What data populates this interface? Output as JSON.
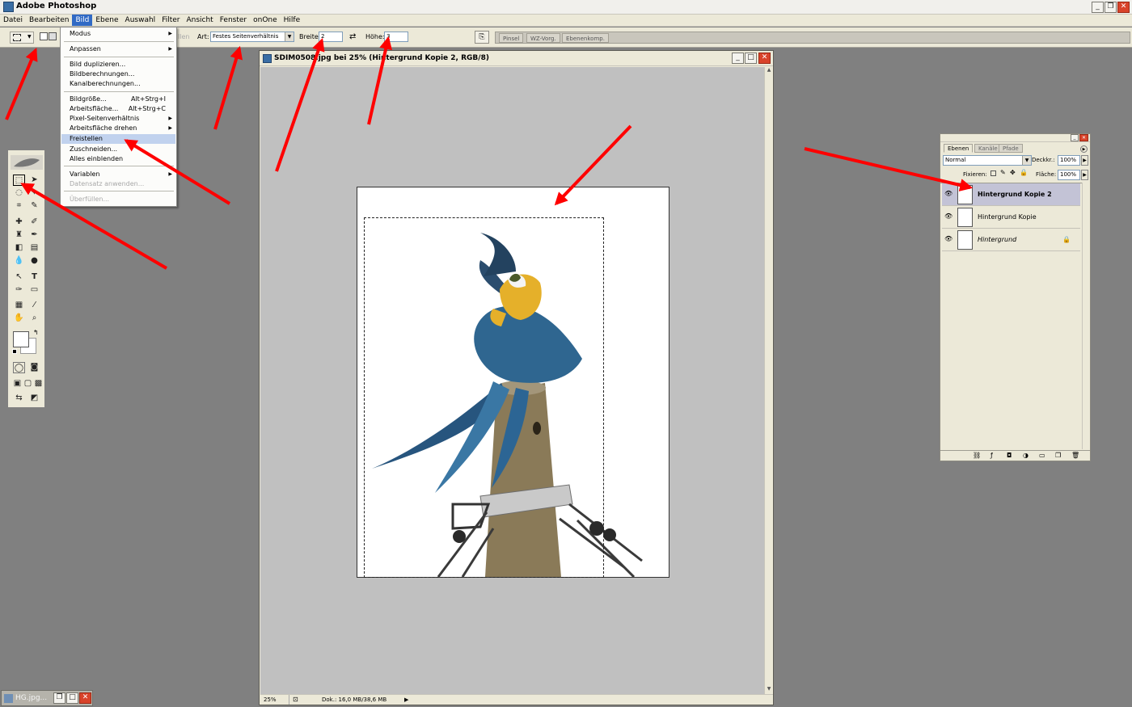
{
  "app": {
    "title": "Adobe Photoshop"
  },
  "menubar": [
    "Datei",
    "Bearbeiten",
    "Bild",
    "Ebene",
    "Auswahl",
    "Filter",
    "Ansicht",
    "Fenster",
    "onOne",
    "Hilfe"
  ],
  "options": {
    "art_label": "Art:",
    "art_value": "Festes Seitenverhältnis",
    "breite_label": "Breite:",
    "breite_value": "2",
    "hoehe_label": "Höhe:",
    "hoehe_value": "3",
    "faded_label": "llen",
    "well_tabs": [
      "Pinsel",
      "WZ-Vorg.",
      "Ebenenkomp."
    ]
  },
  "bild_menu": {
    "items": [
      {
        "label": "Modus",
        "submenu": true
      },
      {
        "label": "Anpassen",
        "submenu": true
      },
      {
        "label": "Bild duplizieren..."
      },
      {
        "label": "Bildberechnungen..."
      },
      {
        "label": "Kanalberechnungen..."
      },
      {
        "label": "Bildgröße...",
        "shortcut": "Alt+Strg+I"
      },
      {
        "label": "Arbeitsfläche...",
        "shortcut": "Alt+Strg+C"
      },
      {
        "label": "Pixel-Seitenverhältnis",
        "submenu": true
      },
      {
        "label": "Arbeitsfläche drehen",
        "submenu": true
      },
      {
        "label": "Freistellen",
        "highlighted": true
      },
      {
        "label": "Zuschneiden..."
      },
      {
        "label": "Alles einblenden"
      },
      {
        "label": "Variablen",
        "submenu": true
      },
      {
        "label": "Datensatz anwenden...",
        "disabled": true
      },
      {
        "label": "Überfüllen...",
        "disabled": true
      }
    ]
  },
  "document": {
    "title": "SDIM0508.jpg bei 25% (Hintergrund Kopie 2, RGB/8)",
    "zoom": "25%",
    "doc_info": "Dok.: 16,0 MB/38,6 MB"
  },
  "layers_panel": {
    "tabs": [
      "Ebenen",
      "Kanäle",
      "Pfade"
    ],
    "blend_mode": "Normal",
    "opacity_label": "Deckkr.:",
    "opacity_value": "100%",
    "lock_label": "Fixieren:",
    "fill_label": "Fläche:",
    "fill_value": "100%",
    "layers": [
      {
        "name": "Hintergrund Kopie 2",
        "selected": true
      },
      {
        "name": "Hintergrund Kopie"
      },
      {
        "name": "Hintergrund",
        "locked": true
      }
    ]
  },
  "minimized_doc": {
    "title": "HG.jpg..."
  },
  "colors": {
    "annotation_arrow": "#ff0000",
    "menu_highlight": "#c1d2ee",
    "selected_layer": "#c3c3d6"
  }
}
